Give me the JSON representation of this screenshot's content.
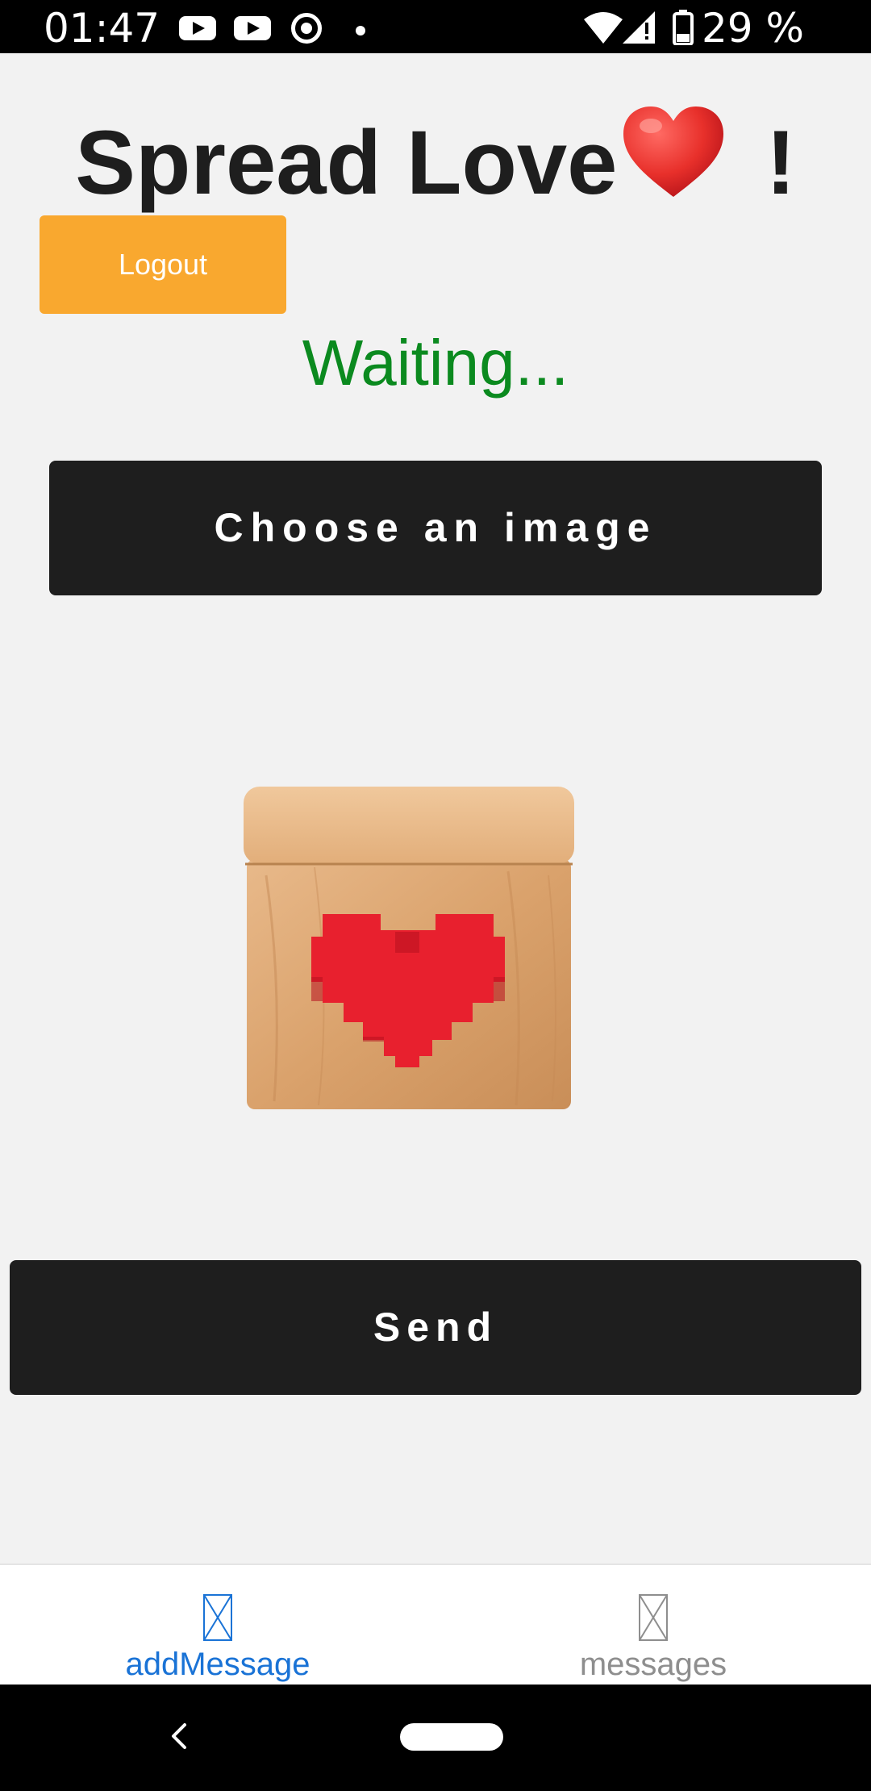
{
  "status_bar": {
    "time": "01:47",
    "battery_percent": "29 %",
    "icons": [
      "youtube-icon",
      "youtube-icon",
      "chrome-icon",
      "notification-dot-icon",
      "wifi-icon",
      "signal-icon",
      "battery-icon"
    ]
  },
  "header": {
    "title_prefix": "Spread Love",
    "title_emoji": "❤️",
    "title_suffix": "!"
  },
  "logout": {
    "label": "Logout"
  },
  "status": {
    "text": "Waiting...",
    "color": "#0b8a1f"
  },
  "choose_image": {
    "label": "Choose an image"
  },
  "preview": {
    "icon": "wooden-heart-box-image"
  },
  "send": {
    "label": "Send"
  },
  "tabs": [
    {
      "label": "addMessage",
      "active": true,
      "icon": "placeholder-icon"
    },
    {
      "label": "messages",
      "active": false,
      "icon": "placeholder-icon"
    }
  ],
  "colors": {
    "accent": "#f9a82f",
    "button_dark": "#1e1e1e",
    "tab_active": "#1a73d6",
    "tab_inactive": "#8e8e8e",
    "background": "#f2f2f2"
  }
}
